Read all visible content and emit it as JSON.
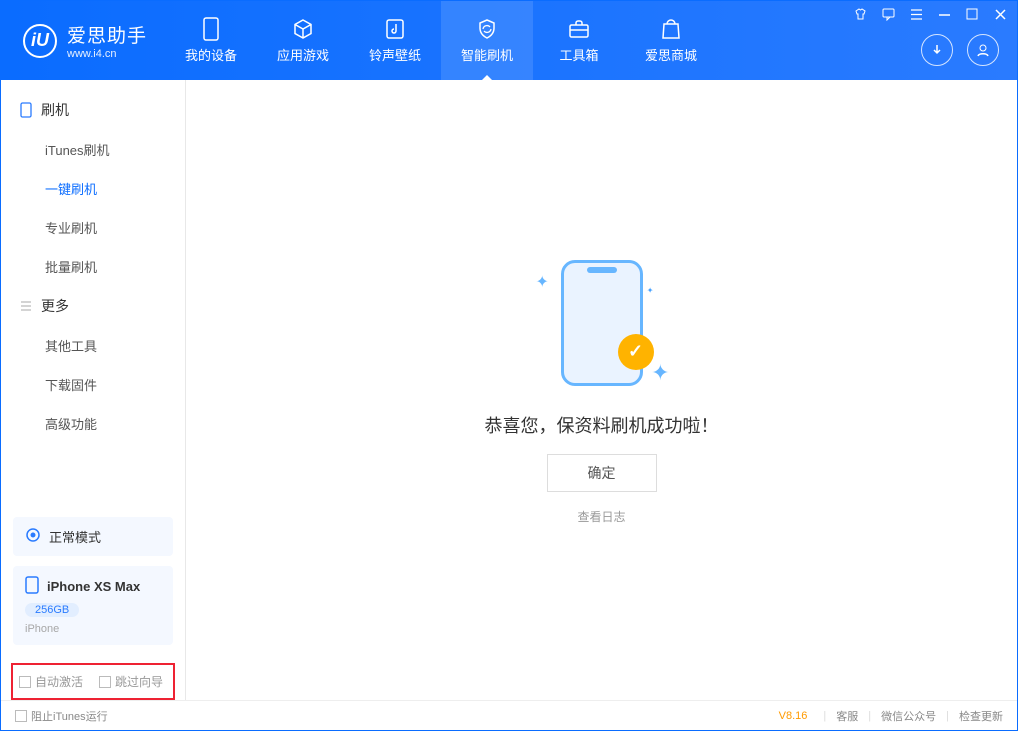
{
  "logo": {
    "brand": "爱思助手",
    "url": "www.i4.cn",
    "mark": "iU"
  },
  "nav": {
    "items": [
      {
        "label": "我的设备"
      },
      {
        "label": "应用游戏"
      },
      {
        "label": "铃声壁纸"
      },
      {
        "label": "智能刷机"
      },
      {
        "label": "工具箱"
      },
      {
        "label": "爱思商城"
      }
    ]
  },
  "sidebar": {
    "group1_title": "刷机",
    "group1_items": [
      "iTunes刷机",
      "一键刷机",
      "专业刷机",
      "批量刷机"
    ],
    "group2_title": "更多",
    "group2_items": [
      "其他工具",
      "下载固件",
      "高级功能"
    ]
  },
  "device": {
    "mode": "正常模式",
    "name": "iPhone XS Max",
    "storage": "256GB",
    "type": "iPhone"
  },
  "options": {
    "auto_activate": "自动激活",
    "skip_guide": "跳过向导"
  },
  "main": {
    "success": "恭喜您，保资料刷机成功啦！",
    "ok": "确定",
    "view_log": "查看日志"
  },
  "footer": {
    "block_itunes": "阻止iTunes运行",
    "version": "V8.16",
    "links": [
      "客服",
      "微信公众号",
      "检查更新"
    ]
  }
}
